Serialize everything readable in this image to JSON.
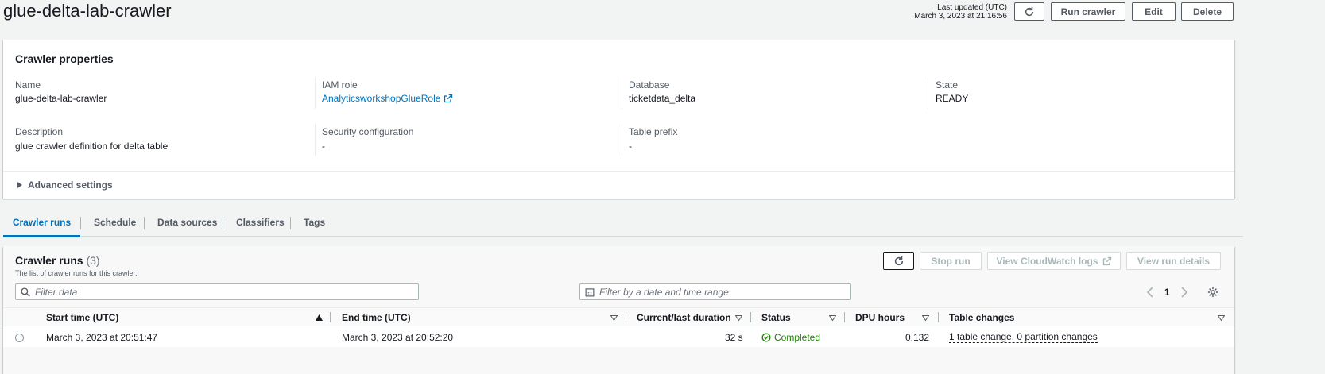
{
  "page": {
    "title": "glue-delta-lab-crawler",
    "last_updated_label": "Last updated (UTC)",
    "last_updated_value": "March 3, 2023 at 21:16:56",
    "run_crawler": "Run crawler",
    "edit": "Edit",
    "delete": "Delete"
  },
  "properties": {
    "title": "Crawler properties",
    "name_label": "Name",
    "name_value": "glue-delta-lab-crawler",
    "iam_label": "IAM role",
    "iam_value": "AnalyticsworkshopGlueRole",
    "database_label": "Database",
    "database_value": "ticketdata_delta",
    "state_label": "State",
    "state_value": "READY",
    "description_label": "Description",
    "description_value": "glue crawler definition for delta table",
    "security_label": "Security configuration",
    "security_value": "-",
    "prefix_label": "Table prefix",
    "prefix_value": "-",
    "advanced": "Advanced settings"
  },
  "tabs": [
    "Crawler runs",
    "Schedule",
    "Data sources",
    "Classifiers",
    "Tags"
  ],
  "runs": {
    "title": "Crawler runs",
    "count": "(3)",
    "description": "The list of crawler runs for this crawler.",
    "stop_run": "Stop run",
    "view_logs": "View CloudWatch logs",
    "view_details": "View run details",
    "filter_placeholder": "Filter data",
    "date_placeholder": "Filter by a date and time range",
    "page": "1",
    "columns": [
      "Start time (UTC)",
      "End time (UTC)",
      "Current/last duration",
      "Status",
      "DPU hours",
      "Table changes"
    ],
    "rows": [
      {
        "start": "March 3, 2023 at 20:51:47",
        "end": "March 3, 2023 at 20:52:20",
        "duration": "32 s",
        "status": "Completed",
        "dpu": "0.132",
        "changes": "1 table change, 0 partition changes"
      }
    ]
  },
  "colors": {
    "link": "#0073bb",
    "success": "#1d8102",
    "background": "#f2f3f3"
  }
}
